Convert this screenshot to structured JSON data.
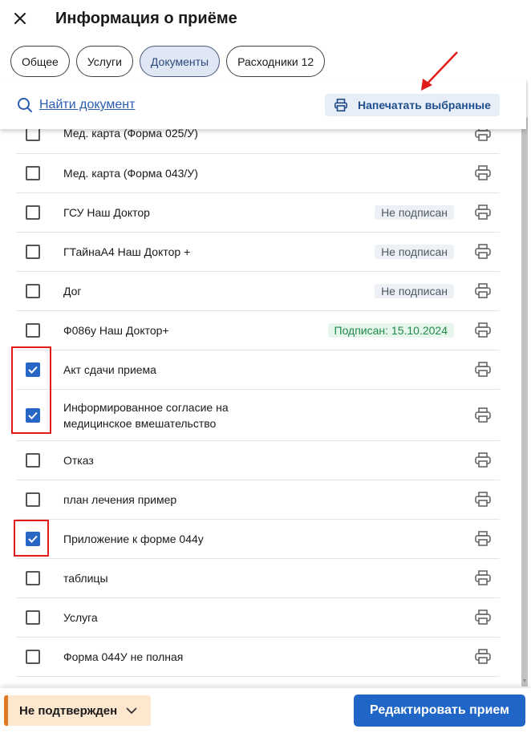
{
  "header": {
    "title": "Информация о приёме",
    "close_icon": "close-icon"
  },
  "tabs": [
    {
      "label": "Общее",
      "active": false
    },
    {
      "label": "Услуги",
      "active": false
    },
    {
      "label": "Документы",
      "active": true
    },
    {
      "label": "Расходники 12",
      "active": false
    }
  ],
  "toolbar": {
    "find_label": "Найти документ",
    "find_icon": "search-icon",
    "print_selected_label": "Напечатать выбранные",
    "print_icon": "printer-icon"
  },
  "documents": [
    {
      "name": "Мед. карта (Форма 025/У)",
      "checked": false,
      "status": ""
    },
    {
      "name": "Мед. карта (Форма 043/У)",
      "checked": false,
      "status": ""
    },
    {
      "name": "ГСУ Наш Доктор",
      "checked": false,
      "status": "Не подписан"
    },
    {
      "name": "ГТайнаА4 Наш Доктор +",
      "checked": false,
      "status": "Не подписан"
    },
    {
      "name": "Дог",
      "checked": false,
      "status": "Не подписан"
    },
    {
      "name": "Ф086у Наш Доктор+",
      "checked": false,
      "status": "Подписан: 15.10.2024"
    },
    {
      "name": "Акт сдачи приема",
      "checked": true,
      "status": ""
    },
    {
      "name": "Информированное согласие на медицинское вмешательство",
      "checked": true,
      "status": ""
    },
    {
      "name": "Отказ",
      "checked": false,
      "status": ""
    },
    {
      "name": "план лечения пример",
      "checked": false,
      "status": ""
    },
    {
      "name": "Приложение к форме 044у",
      "checked": true,
      "status": ""
    },
    {
      "name": "таблицы",
      "checked": false,
      "status": ""
    },
    {
      "name": "Услуга",
      "checked": false,
      "status": ""
    },
    {
      "name": "Форма 044У не полная",
      "checked": false,
      "status": ""
    }
  ],
  "footer": {
    "status_label": "Не подтвержден",
    "edit_label": "Редактировать прием"
  },
  "colors": {
    "accent": "#1f66c7",
    "signed": "#1e8a4a",
    "status_warning": "#e07a22",
    "annotation": "#e01b1b"
  }
}
